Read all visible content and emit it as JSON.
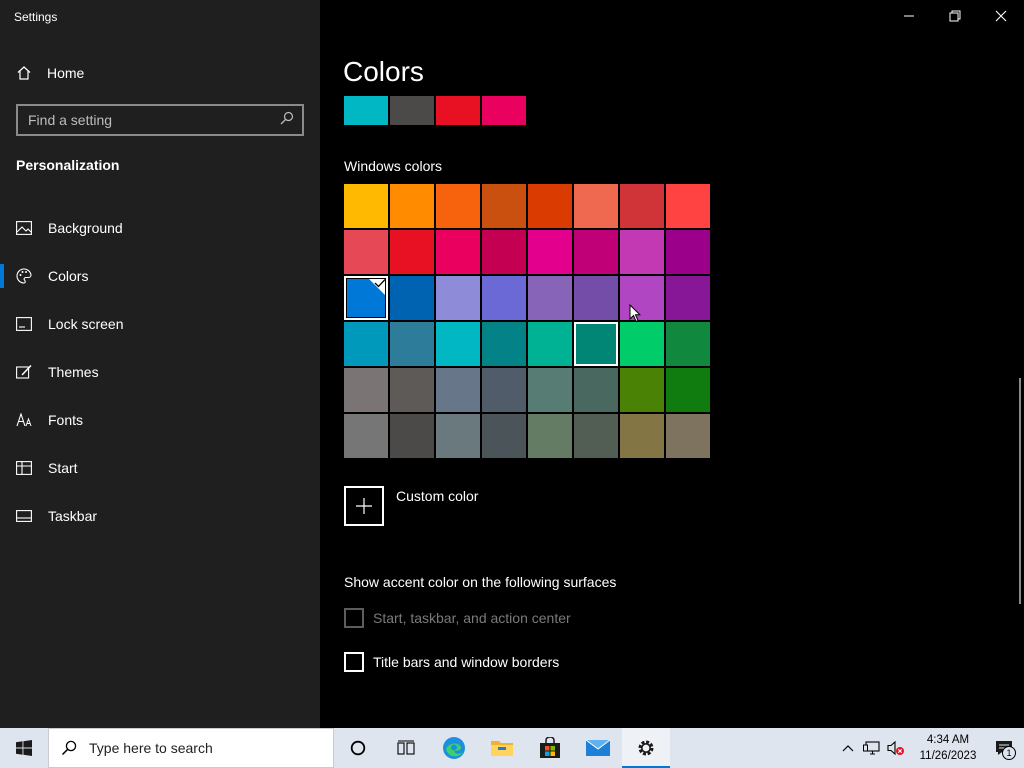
{
  "window": {
    "title": "Settings"
  },
  "sidebar": {
    "home_label": "Home",
    "search_placeholder": "Find a setting",
    "section_title": "Personalization",
    "items": [
      {
        "label": "Background",
        "icon": "picture-icon"
      },
      {
        "label": "Colors",
        "icon": "palette-icon",
        "active": true
      },
      {
        "label": "Lock screen",
        "icon": "lock-screen-icon"
      },
      {
        "label": "Themes",
        "icon": "brush-icon"
      },
      {
        "label": "Fonts",
        "icon": "font-icon"
      },
      {
        "label": "Start",
        "icon": "start-icon"
      },
      {
        "label": "Taskbar",
        "icon": "taskbar-icon"
      }
    ]
  },
  "main": {
    "title": "Colors",
    "recent_colors": [
      "#00b7c3",
      "#4c4a48",
      "#e81123",
      "#ea005e"
    ],
    "windows_colors_label": "Windows colors",
    "windows_colors": [
      [
        "#ffb900",
        "#ff8c00",
        "#f7630c",
        "#ca5010",
        "#da3b01",
        "#ef6950",
        "#d13438",
        "#ff4343"
      ],
      [
        "#e74856",
        "#e81123",
        "#ea005e",
        "#c30052",
        "#e3008c",
        "#bf0077",
        "#c239b3",
        "#9a0089"
      ],
      [
        "#0078d7",
        "#0063b1",
        "#8e8cd8",
        "#6b69d6",
        "#8764b8",
        "#744da9",
        "#b146c2",
        "#881798"
      ],
      [
        "#0099bc",
        "#2d7d9a",
        "#00b7c3",
        "#038387",
        "#00b294",
        "#018574",
        "#00cc6a",
        "#10893e"
      ],
      [
        "#7a7574",
        "#5d5a58",
        "#68768a",
        "#515c6b",
        "#567c73",
        "#486860",
        "#498205",
        "#107c10"
      ],
      [
        "#767676",
        "#4c4a48",
        "#69797e",
        "#4a5459",
        "#647c64",
        "#525e54",
        "#847545",
        "#7e735f"
      ]
    ],
    "selected_color": "#0078d7",
    "custom_color_label": "Custom color",
    "surfaces_label": "Show accent color on the following surfaces",
    "options": [
      {
        "label": "Start, taskbar, and action center",
        "checked": false,
        "disabled": true
      },
      {
        "label": "Title bars and window borders",
        "checked": false,
        "disabled": false
      }
    ]
  },
  "taskbar": {
    "search_placeholder": "Type here to search",
    "time": "4:34 AM",
    "date": "11/26/2023",
    "notification_count": "1"
  },
  "accent": "#0078d7"
}
